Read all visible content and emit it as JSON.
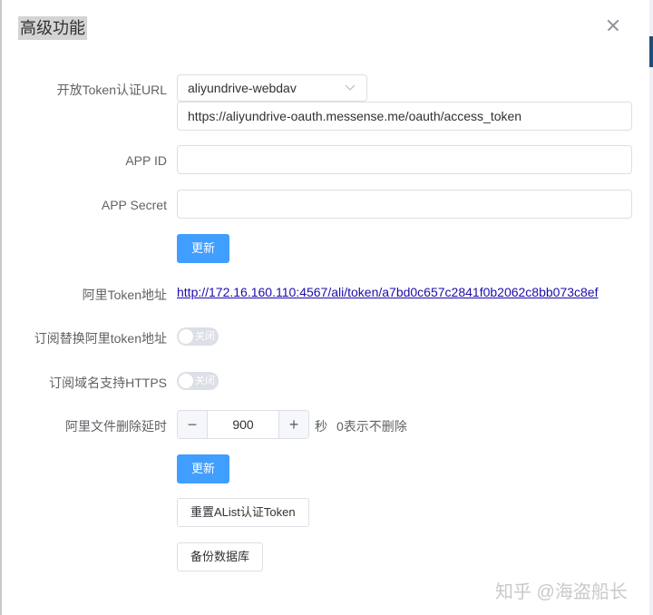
{
  "dialog": {
    "title": "高级功能"
  },
  "token_url": {
    "label": "开放Token认证URL",
    "provider_selected": "aliyundrive-webdav",
    "url_value": "https://aliyundrive-oauth.messense.me/oauth/access_token"
  },
  "app_id": {
    "label": "APP ID",
    "value": ""
  },
  "app_secret": {
    "label": "APP Secret",
    "value": ""
  },
  "buttons": {
    "update_1": "更新",
    "update_2": "更新",
    "reset_alist_token": "重置AList认证Token",
    "backup_database": "备份数据库"
  },
  "ali_token": {
    "label": "阿里Token地址",
    "link": "http://172.16.160.110:4567/ali/token/a7bd0c657c2841f0b2062c8bb073c8ef"
  },
  "subscription_replace": {
    "label": "订阅替换阿里token地址",
    "switch_text": "关闭",
    "enabled": false
  },
  "subscription_https": {
    "label": "订阅域名支持HTTPS",
    "switch_text": "关闭",
    "enabled": false
  },
  "delete_delay": {
    "label": "阿里文件删除延时",
    "minus": "−",
    "plus": "+",
    "value": "900",
    "unit": "秒",
    "hint": "0表示不删除"
  },
  "watermark": "知乎 @海盗船长",
  "icons": {
    "close": "close-icon",
    "dropdown": "chevron-down-icon"
  },
  "colors": {
    "primary": "#409eff",
    "link": "#1a0dab",
    "switch_off": "#dcdfe6",
    "title_highlight": "#d4d4d4"
  }
}
